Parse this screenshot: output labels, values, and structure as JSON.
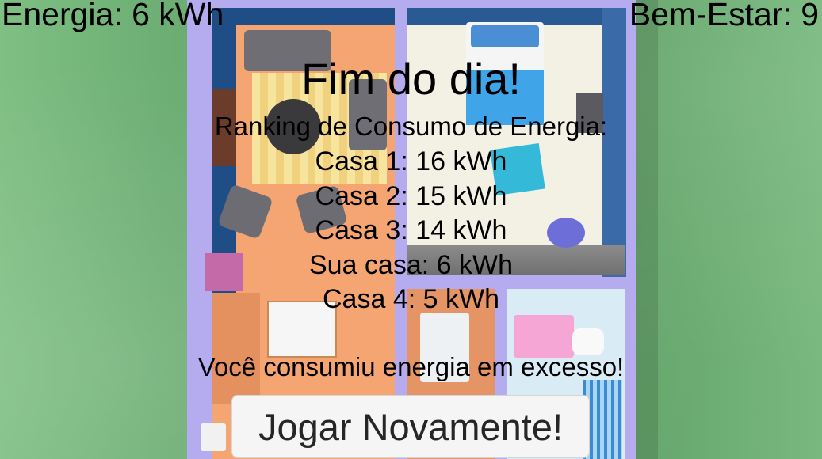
{
  "hud": {
    "energy_label": "Energia: 6 kWh",
    "wellbeing_label": "Bem-Estar: 9"
  },
  "end_panel": {
    "title": "Fim do dia!",
    "ranking_title": "Ranking de Consumo de Energia:",
    "ranking": [
      "Casa 1: 16 kWh",
      "Casa 2: 15 kWh",
      "Casa 3: 14 kWh",
      "Sua casa: 6 kWh",
      "Casa 4: 5 kWh"
    ],
    "message": "Você consumiu energia em excesso!",
    "play_again_label": "Jogar Novamente!"
  },
  "colors": {
    "grass": "#6cae73",
    "house_floor_outline": "#b5acf0",
    "living_floor": "#f4a572",
    "wall_blue": "#1f4d85",
    "bedroom_floor": "#f3f1e3",
    "button_bg": "#f5f5f5"
  }
}
